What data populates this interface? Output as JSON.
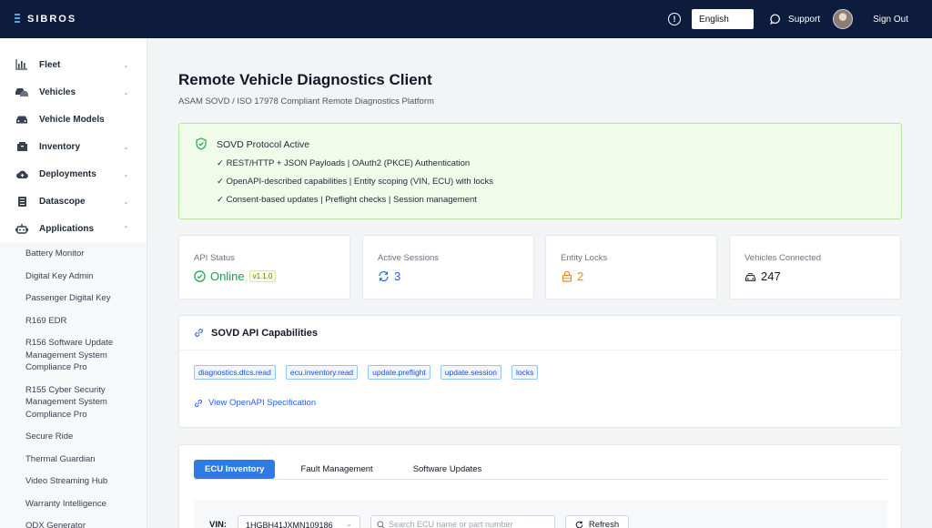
{
  "topbar": {
    "brand": "SIBROS",
    "language": "English",
    "support_label": "Support",
    "signout_label": "Sign Out"
  },
  "sidebar": {
    "items": [
      {
        "label": "Fleet",
        "icon": "bar-chart-icon",
        "chevron": "down"
      },
      {
        "label": "Vehicles",
        "icon": "vehicles-icon",
        "chevron": "down"
      },
      {
        "label": "Vehicle Models",
        "icon": "car-icon",
        "chevron": ""
      },
      {
        "label": "Inventory",
        "icon": "inventory-icon",
        "chevron": "down"
      },
      {
        "label": "Deployments",
        "icon": "cloud-upload-icon",
        "chevron": "down"
      },
      {
        "label": "Datascope",
        "icon": "datascope-icon",
        "chevron": "down"
      },
      {
        "label": "Applications",
        "icon": "robot-icon",
        "chevron": "up"
      }
    ],
    "applications": [
      "Battery Monitor",
      "Digital Key Admin",
      "Passenger Digital Key",
      "R169 EDR",
      "R156 Software Update Management System Compliance Pro",
      "R155 Cyber Security Management System Compliance Pro",
      "Secure Ride",
      "Thermal Guardian",
      "Video Streaming Hub",
      "Warranty Intelligence",
      "ODX Generator"
    ]
  },
  "main": {
    "title": "Remote Vehicle Diagnostics Client",
    "subtitle": "ASAM SOVD / ISO 17978 Compliant Remote Diagnostics Platform",
    "protocol": {
      "title": "SOVD Protocol Active",
      "lines": [
        "✓ REST/HTTP + JSON Payloads | OAuth2 (PKCE) Authentication",
        "✓ OpenAPI-described capabilities | Entity scoping (VIN, ECU) with locks",
        "✓ Consent-based updates | Preflight checks | Session management"
      ]
    },
    "stats": [
      {
        "label": "API Status",
        "value": "Online",
        "badge": "v1.1.0",
        "icon": "check-circle-icon",
        "color": "#16a34a"
      },
      {
        "label": "Active Sessions",
        "value": "3",
        "icon": "sync-icon",
        "color": "#2563eb"
      },
      {
        "label": "Entity Locks",
        "value": "2",
        "icon": "lock-icon",
        "color": "#ea8a2c"
      },
      {
        "label": "Vehicles Connected",
        "value": "247",
        "icon": "car-connected-icon",
        "color": "#111827"
      }
    ],
    "capabilities": {
      "title": "SOVD API Capabilities",
      "tags": [
        "diagnostics.dtcs.read",
        "ecu.inventory.read",
        "update.preflight",
        "update.session",
        "locks"
      ],
      "link": "View OpenAPI Specification"
    },
    "tabs": [
      "ECU Inventory",
      "Fault Management",
      "Software Updates"
    ],
    "active_tab": "ECU Inventory",
    "filters": {
      "vin_label": "VIN:",
      "vin_value": "1HGBH41JXMN109186",
      "search_placeholder": "Search ECU name or part number",
      "refresh_label": "Refresh"
    }
  },
  "colors": {
    "topbar": "#0d1b3d",
    "accent": "#2f7be6",
    "success": "#16a34a",
    "warning": "#ea8a2c"
  }
}
